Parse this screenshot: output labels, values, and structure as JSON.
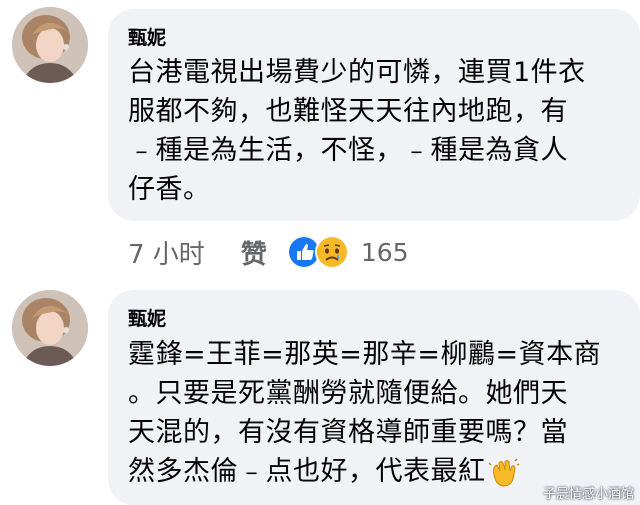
{
  "comments": [
    {
      "author": "甄妮",
      "lines": [
        "台港電視出場費少的可憐，連買1件衣",
        "服都不夠，也難怪天天往內地跑，有",
        "﹣種是為生活，不怪，﹣種是為貪人",
        "仔香。"
      ],
      "time": "7 小时",
      "like_label": "赞",
      "reactions": [
        "like-reaction-icon",
        "sad-reaction-icon"
      ],
      "reaction_count": "165"
    },
    {
      "author": "甄妮",
      "lines": [
        "霆鋒=王菲=那英=那辛=柳鸝=資本商",
        "。只要是死黨酬勞就隨便給。她們天",
        "天混的，有沒有資格導師重要嗎？當",
        "然多杰倫﹣点也好，代表最紅"
      ],
      "trailing_emoji": "clapping-hands-icon"
    }
  ],
  "watermark": "子晨情感小酒馆",
  "colors": {
    "bubble": "#f0f2f5",
    "text": "#050505",
    "meta": "#65676b",
    "like_blue": "#1877f2",
    "sad_yellow": "#f7b928"
  }
}
